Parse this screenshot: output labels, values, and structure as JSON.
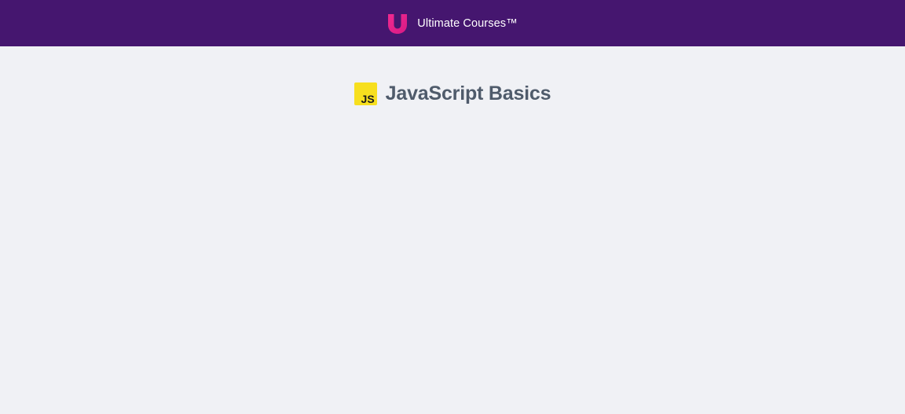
{
  "header": {
    "brand_name": "Ultimate Courses™",
    "logo_icon": "ultimate-courses-u-logo",
    "background_color": "#45166f",
    "logo_color": "#e8218c"
  },
  "course": {
    "badge_text": "JS",
    "badge_icon": "javascript-logo",
    "badge_color": "#f7df1e",
    "title": "JavaScript Basics",
    "title_color": "#4f5b6b"
  }
}
